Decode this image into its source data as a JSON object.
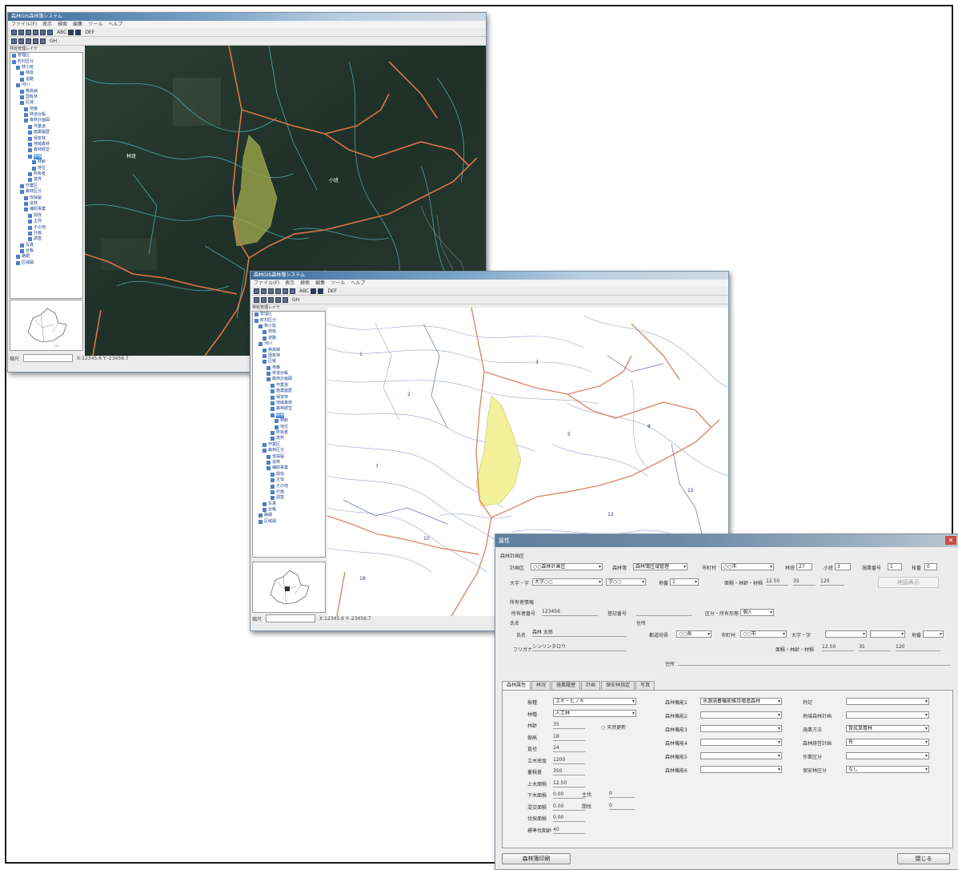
{
  "win1": {
    "title": "森林GIS森林簿システム",
    "menus": [
      "ファイル(F)",
      "表示",
      "検索",
      "編集",
      "ツール",
      "ヘルプ"
    ],
    "toolbar_text": [
      "ABC",
      "DEF",
      "GH"
    ],
    "panel_label": "林班管理レイヤ",
    "tree": [
      "管理区",
      "町村区分",
      "林小班",
      "林班",
      "道路",
      "河川",
      "等高線",
      "国有林",
      "区域",
      "地番",
      "林道台帳",
      "森林計画図",
      "作業道",
      "施業履歴",
      "保安林",
      "地域森林",
      "森林経営",
      "樹種",
      "林齢",
      "地位",
      "所有者",
      "境界",
      "作業区",
      "森林区分",
      "伐採届",
      "造林",
      "補助事業",
      "間伐",
      "主伐",
      "その他",
      "計画",
      "調査",
      "写真",
      "台帳",
      "路網",
      "区域図"
    ],
    "status_label": "縮尺",
    "status_coord": "X:12345.6 Y:-23456.7",
    "map_labels": [
      "林班",
      "小班"
    ]
  },
  "win2": {
    "title": "森林GIS森林簿システム",
    "menus": [
      "ファイル(F)",
      "表示",
      "検索",
      "編集",
      "ツール",
      "ヘルプ"
    ],
    "toolbar_text": [
      "ABC",
      "DEF",
      "GH"
    ],
    "panel_label": "林班管理レイヤ",
    "tree": [
      "管理区",
      "町村区分",
      "林小班",
      "林班",
      "道路",
      "河川",
      "等高線",
      "国有林",
      "区域",
      "地番",
      "林道台帳",
      "森林計画図",
      "作業道",
      "施業履歴",
      "保安林",
      "地域森林",
      "森林経営",
      "樹種",
      "林齢",
      "地位",
      "所有者",
      "境界",
      "作業区",
      "森林区分",
      "伐採届",
      "造林",
      "補助事業",
      "間伐",
      "主伐",
      "その他",
      "計画",
      "調査",
      "写真",
      "台帳",
      "路網",
      "区域図"
    ],
    "status_label": "縮尺",
    "status_coord": "X:12345.6 Y:-23456.7",
    "map_labels": [
      "1",
      "2",
      "3",
      "5",
      "7",
      "8",
      "10",
      "12",
      "15",
      "18"
    ]
  },
  "form": {
    "title": "属性",
    "section1": "森林計画区",
    "r1": [
      {
        "label": "計画区",
        "value": "○○森林計画区"
      },
      {
        "label": "森林簿",
        "value": "森林簿区域管理"
      },
      {
        "label": "市町村",
        "value": "○○市"
      },
      {
        "label": "林班",
        "value": "27"
      },
      {
        "label": "小班",
        "value": "3"
      },
      {
        "label": "施業番号",
        "value": "1"
      },
      {
        "label": "枝番",
        "value": "0"
      }
    ],
    "r2": [
      {
        "label": "大字・字",
        "value": "大字○○"
      },
      {
        "label": "",
        "value": "字○○"
      },
      {
        "label": "地番",
        "value": "1"
      },
      {
        "label": "面積・林齢・材積",
        "value": "12.50"
      },
      {
        "label": "",
        "value": "35"
      },
      {
        "label": "",
        "value": "120"
      }
    ],
    "r2_button": "地図表示",
    "section2": "所有者情報",
    "owner_no_label": "所有者番号",
    "owner_no": "123456",
    "reg_label": "登記番号",
    "reg_value": "",
    "kubun_label": "区分・所有形態",
    "kubun_value": "個人",
    "sect_name": "氏名",
    "sect_addr": "住所",
    "name_label": "氏名",
    "name_value": "森林 太郎",
    "furigana_label": "フリガナ",
    "furigana_value": "シンリンタロウ",
    "addr_fields": [
      {
        "label": "都道府県",
        "value": "○○県"
      },
      {
        "label": "市町村",
        "value": "○○市"
      },
      {
        "label": "大字・字",
        "value": ""
      },
      {
        "label": "",
        "value": ""
      },
      {
        "label": "地番",
        "value": ""
      }
    ],
    "addr2_label": "面積・林齢・材積",
    "addr2_values": [
      "12.50",
      "35",
      "120"
    ],
    "memo_label": "住所",
    "memo_value": "",
    "tabs": [
      "森林属性",
      "林況",
      "施業履歴",
      "計画",
      "保安林指定",
      "写真"
    ],
    "col1": [
      {
        "label": "樹種",
        "value": "スギ・ヒノキ",
        "sel": true
      },
      {
        "label": "林種",
        "value": "人工林",
        "sel": true
      },
      {
        "label": "林齢",
        "value": "35",
        "sel": false
      },
      {
        "label": "樹高",
        "value": "18",
        "sel": false
      },
      {
        "label": "直径",
        "value": "24",
        "sel": false
      },
      {
        "label": "立木密度",
        "value": "1200",
        "sel": false
      },
      {
        "label": "蓄積量",
        "value": "350",
        "sel": false
      },
      {
        "label": "上木面積",
        "value": "12.50",
        "sel": false
      },
      {
        "label": "下木面積",
        "value": "0.00",
        "sel": false
      },
      {
        "label": "混交面積",
        "value": "0.00",
        "sel": false
      },
      {
        "label": "伐採面積",
        "value": "0.00",
        "sel": false
      },
      {
        "label": "標準伐期齢",
        "value": "40",
        "sel": false
      }
    ],
    "col1_check": "○ 天然更新",
    "col1_sub": [
      {
        "label": "主伐",
        "value": "0"
      },
      {
        "label": "間伐",
        "value": "0"
      }
    ],
    "col2": [
      {
        "label": "森林機能1",
        "value": "水源涵養機能維持増進森林"
      },
      {
        "label": "森林機能2",
        "value": ""
      },
      {
        "label": "森林機能3",
        "value": ""
      },
      {
        "label": "森林機能4",
        "value": ""
      },
      {
        "label": "森林機能5",
        "value": ""
      },
      {
        "label": "森林機能6",
        "value": ""
      }
    ],
    "col3": [
      {
        "label": "特記",
        "value": ""
      },
      {
        "label": "地域森林計画",
        "value": ""
      },
      {
        "label": "施業方法",
        "value": "育成単層林"
      },
      {
        "label": "森林経営計画",
        "value": "有"
      },
      {
        "label": "作業区分",
        "value": ""
      },
      {
        "label": "保安林区分",
        "value": "なし"
      }
    ],
    "bottom_left_button": "森林簿印刷",
    "bottom_right_button": "閉じる"
  }
}
